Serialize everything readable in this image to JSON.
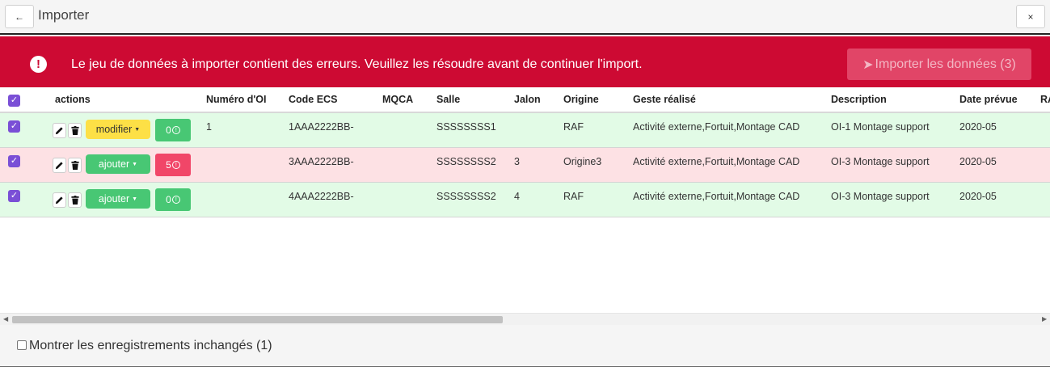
{
  "window": {
    "title": "Importer",
    "back_icon": "←",
    "close_icon": "×"
  },
  "banner": {
    "icon": "!",
    "message": "Le jeu de données à importer contient des erreurs. Veuillez les résoudre avant de continuer l'import.",
    "import_button_icon": "➤",
    "import_button_label": "Importer les données (3)",
    "color": "#cd0a33"
  },
  "table": {
    "columns": [
      "actions",
      "Numéro d'OI",
      "Code ECS",
      "MQCA",
      "Salle",
      "Jalon",
      "Origine",
      "Geste réalisé",
      "Description",
      "Date prévue",
      "RA"
    ],
    "rows": [
      {
        "status": "ok",
        "checked": true,
        "action": "modifier",
        "action_color": "yellow",
        "count": "0",
        "count_color": "green",
        "numero_oi": "1",
        "code_ecs": "1AAA2222BB-",
        "mqca": "",
        "salle": "SSSSSSSS1",
        "jalon": "",
        "origine": "RAF",
        "geste": "Activité externe,Fortuit,Montage CAD",
        "description": "OI-1 Montage support",
        "date": "2020-05"
      },
      {
        "status": "err",
        "checked": true,
        "action": "ajouter",
        "action_color": "green",
        "count": "5",
        "count_color": "red",
        "numero_oi": "",
        "code_ecs": "3AAA2222BB-",
        "mqca": "",
        "salle": "SSSSSSSS2",
        "jalon": "3",
        "origine": "Origine3",
        "geste": "Activité externe,Fortuit,Montage CAD",
        "description": "OI-3 Montage support",
        "date": "2020-05"
      },
      {
        "status": "ok",
        "checked": true,
        "action": "ajouter",
        "action_color": "green",
        "count": "0",
        "count_color": "green",
        "numero_oi": "",
        "code_ecs": "4AAA2222BB-",
        "mqca": "",
        "salle": "SSSSSSSS2",
        "jalon": "4",
        "origine": "RAF",
        "geste": "Activité externe,Fortuit,Montage CAD",
        "description": "OI-3 Montage support",
        "date": "2020-05"
      }
    ]
  },
  "footer": {
    "checkbox_label": "Montrer les enregistrements inchangés (1)",
    "checked": false
  },
  "colors": {
    "row_ok": "#e2fbe6",
    "row_error": "#fde1e4",
    "checkbox_accent": "#7a4fd6",
    "modifier_button": "#fde046",
    "ajouter_button": "#48c774",
    "error_count": "#f14668"
  }
}
